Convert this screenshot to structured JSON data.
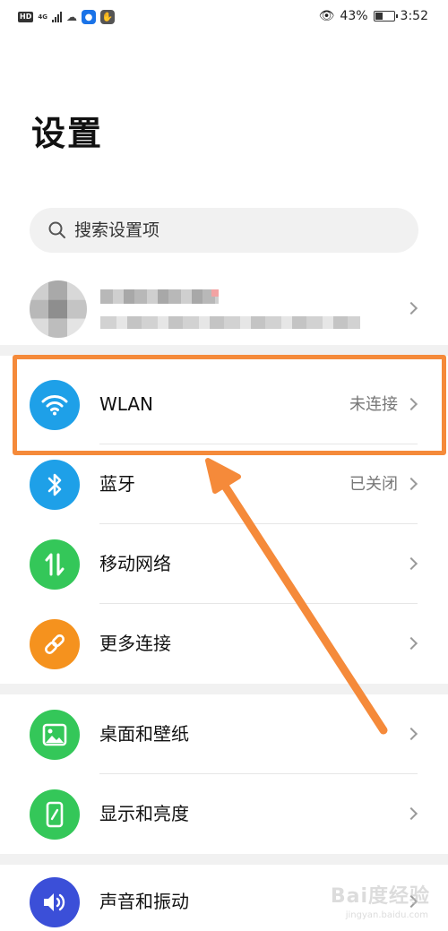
{
  "status_bar": {
    "hd": "HD",
    "network": "4G",
    "battery_text": "43%",
    "battery_level": 0.43,
    "time": "3:52",
    "icons": [
      "hd-icon",
      "signal-icon",
      "cloud-icon",
      "app-notification-icon",
      "app-notification-icon-2",
      "eye-comfort-icon",
      "battery-icon"
    ]
  },
  "page": {
    "title": "设置"
  },
  "search": {
    "placeholder": "搜索设置项",
    "value": ""
  },
  "rows": [
    {
      "key": "wlan",
      "label": "WLAN",
      "status": "未连接",
      "icon": "wifi-icon",
      "icon_color": "#1ea0e8"
    },
    {
      "key": "bluetooth",
      "label": "蓝牙",
      "status": "已关闭",
      "icon": "bluetooth-icon",
      "icon_color": "#1ea0e8"
    },
    {
      "key": "mobile-network",
      "label": "移动网络",
      "status": "",
      "icon": "mobile-data-icon",
      "icon_color": "#34c759"
    },
    {
      "key": "more-connections",
      "label": "更多连接",
      "status": "",
      "icon": "link-icon",
      "icon_color": "#f5921e"
    },
    {
      "key": "wallpaper",
      "label": "桌面和壁纸",
      "status": "",
      "icon": "image-icon",
      "icon_color": "#34c759"
    },
    {
      "key": "display",
      "label": "显示和亮度",
      "status": "",
      "icon": "phone-brightness-icon",
      "icon_color": "#34c759"
    },
    {
      "key": "sound",
      "label": "声音和振动",
      "status": "",
      "icon": "volume-icon",
      "icon_color": "#3b4fd8"
    }
  ],
  "annotation": {
    "color": "#f58a3a"
  },
  "watermark": {
    "text": "Bai度经验",
    "sub": "jingyan.baidu.com"
  }
}
